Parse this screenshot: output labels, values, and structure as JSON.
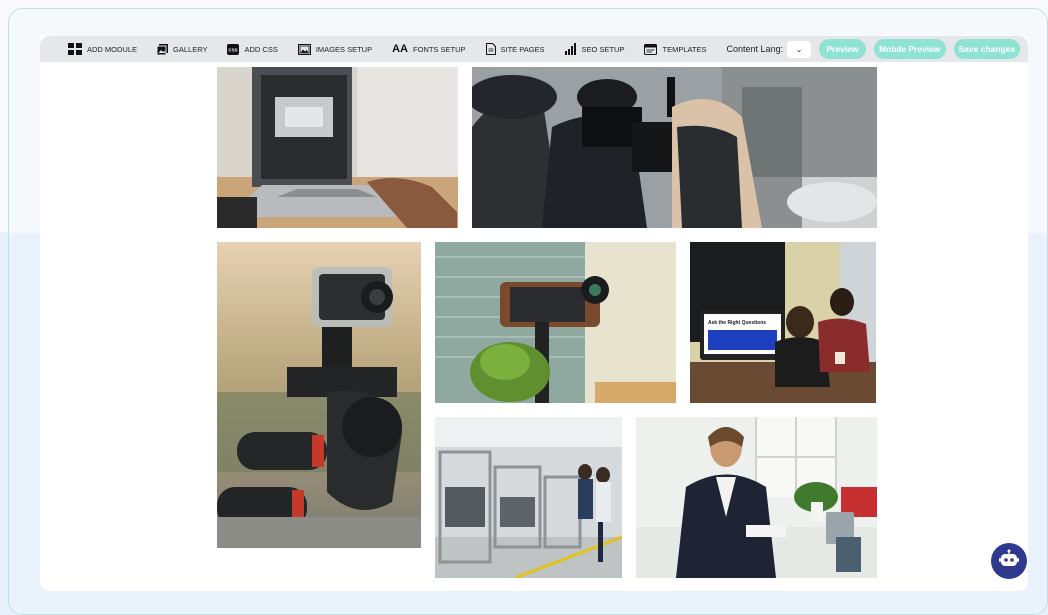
{
  "toolbar": {
    "items": [
      {
        "label": "ADD MODULE",
        "icon": "grid-icon"
      },
      {
        "label": "GALLERY",
        "icon": "gallery-icon"
      },
      {
        "label": "ADD CSS",
        "icon": "css-icon"
      },
      {
        "label": "IMAGES SETUP",
        "icon": "image-icon"
      },
      {
        "label": "FONTS SETUP",
        "icon": "fonts-icon",
        "glyph": "Aa"
      },
      {
        "label": "SITE PAGES",
        "icon": "document-icon"
      },
      {
        "label": "SEO SETUP",
        "icon": "seo-chart-icon"
      },
      {
        "label": "TEMPLATES",
        "icon": "templates-icon"
      }
    ],
    "content_lang_label": "Content Lang:",
    "lang_chevron": "⌄",
    "buttons": {
      "preview": "Preview",
      "mobile_preview": "Mobile Preview",
      "save": "Save changes"
    },
    "css_badge": "CSS"
  },
  "colors": {
    "accent_button": "#8fe3d2",
    "toolbar_bg": "#e6e7eb",
    "chat_bot_bg": "#2f3a8f"
  },
  "gallery": {
    "images": [
      {
        "subject": "laptop-on-desk"
      },
      {
        "subject": "film-crew-with-camera"
      },
      {
        "subject": "action-camera-on-mount"
      },
      {
        "subject": "phone-gimbal-stabilizer"
      },
      {
        "subject": "meeting-with-monitor"
      },
      {
        "subject": "factory-workers"
      },
      {
        "subject": "call-center-agent"
      }
    ],
    "monitor_headline": "Ask the Right Questions"
  }
}
